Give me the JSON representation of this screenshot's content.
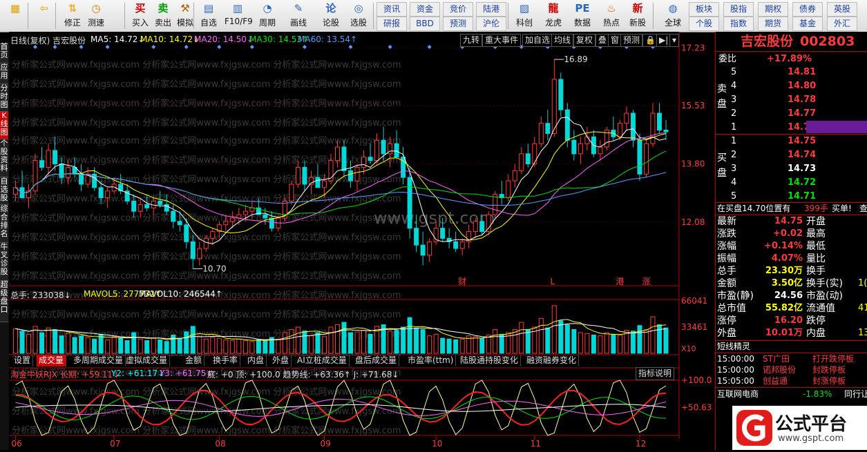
{
  "toolbar": {
    "buttons": [
      {
        "label": "",
        "icon": "grid-icon"
      },
      {
        "label": "",
        "icon": "back-arrow-icon"
      },
      {
        "label": "修正",
        "icon": "updown-icon"
      },
      {
        "label": "测速",
        "icon": "clock-icon"
      },
      {
        "label": "买入",
        "icon": "buy-icon"
      },
      {
        "label": "卖出",
        "icon": "sell-icon"
      },
      {
        "label": "模拟",
        "icon": "hammer-icon"
      },
      {
        "label": "自选",
        "icon": "folder-icon"
      },
      {
        "label": "F10/F9",
        "icon": "f10-icon"
      },
      {
        "label": "周期",
        "icon": "period-icon"
      },
      {
        "label": "画线",
        "icon": "pen-icon"
      },
      {
        "label": "论股",
        "icon": "discuss-icon"
      },
      {
        "label": "选股",
        "icon": "select-icon"
      }
    ],
    "links_row1": [
      "资讯",
      "资金",
      "竞价",
      "陆港"
    ],
    "links_row2": [
      "研报",
      "BBD",
      "预测",
      "沪伦"
    ],
    "buttons2": [
      {
        "label": "科创",
        "icon": "chart-icon"
      },
      {
        "label": "龙虎",
        "icon": "dragon-icon"
      },
      {
        "label": "数据",
        "icon": "pe-icon"
      },
      {
        "label": "热点",
        "icon": "hot-icon"
      },
      {
        "label": "新股",
        "icon": "ipo-icon"
      },
      {
        "label": "全球",
        "icon": "globe-icon"
      }
    ],
    "links2_row1": [
      "板块",
      "股指",
      "期权",
      "债券",
      "英股"
    ],
    "links2_row2": [
      "个股",
      "指数",
      "期货",
      "基金",
      "外汇"
    ]
  },
  "left_tabs": [
    "首页",
    "应用",
    "分时图",
    "K线图",
    "个股资料",
    "自选股",
    "综合排名",
    "牛叉诊股",
    "超级盘口"
  ],
  "header": {
    "title": "日线(复权)  吉宏股份",
    "ma5": "MA5: 14.72↓",
    "ma10": "MA10: 14.72↓",
    "ma20": "MA20: 14.50↓",
    "ma30": "MA30: 14.53↑",
    "ma60": "MA60: 13.54↑"
  },
  "chart_tabs": [
    "九转",
    "重大事件",
    "加自选",
    "均线",
    "复权",
    "叠",
    "窗",
    "预测"
  ],
  "chart_data": {
    "type": "candlestick",
    "title": "吉宏股份 002803 日线(复权)",
    "y_ticks": [
      "17.23",
      "15.53",
      "13.80",
      "12.08"
    ],
    "ylim": [
      10.2,
      17.3
    ],
    "x_labels": [
      "06",
      "07",
      "08",
      "09",
      "10",
      "11",
      "12"
    ],
    "annotations": [
      "16.89",
      "10.70"
    ],
    "event_marks": [
      "财",
      "L",
      "港",
      "涨"
    ],
    "watermark": "分析家公式网www.fxjgsw.com",
    "watermark2": "www.gspt.com",
    "candles": [
      [
        12.9,
        13.3,
        12.7,
        13.1
      ],
      [
        13.1,
        13.6,
        12.9,
        12.8
      ],
      [
        12.8,
        13.2,
        12.5,
        13.0
      ],
      [
        13.0,
        14.1,
        12.9,
        13.9
      ],
      [
        13.9,
        14.3,
        13.6,
        13.7
      ],
      [
        13.7,
        14.4,
        13.5,
        14.2
      ],
      [
        14.2,
        14.6,
        13.6,
        13.8
      ],
      [
        13.8,
        14.0,
        13.2,
        13.4
      ],
      [
        13.4,
        13.9,
        13.2,
        13.7
      ],
      [
        13.7,
        14.0,
        13.4,
        13.5
      ],
      [
        13.5,
        13.8,
        13.0,
        13.2
      ],
      [
        13.2,
        13.7,
        13.1,
        13.5
      ],
      [
        13.5,
        13.7,
        13.0,
        13.1
      ],
      [
        13.1,
        13.3,
        12.6,
        12.8
      ],
      [
        12.8,
        13.1,
        12.5,
        13.0
      ],
      [
        13.0,
        13.4,
        12.9,
        13.2
      ],
      [
        13.2,
        13.5,
        12.9,
        13.0
      ],
      [
        13.0,
        13.2,
        12.6,
        12.7
      ],
      [
        12.7,
        12.9,
        12.2,
        12.4
      ],
      [
        12.4,
        12.8,
        12.2,
        12.6
      ],
      [
        12.6,
        12.9,
        12.4,
        12.5
      ],
      [
        12.5,
        12.8,
        12.3,
        12.7
      ],
      [
        12.7,
        13.0,
        12.5,
        12.6
      ],
      [
        12.6,
        12.9,
        12.3,
        12.4
      ],
      [
        12.4,
        12.6,
        11.9,
        12.1
      ],
      [
        12.1,
        12.4,
        11.8,
        12.0
      ],
      [
        12.0,
        12.2,
        11.3,
        11.5
      ],
      [
        11.5,
        11.7,
        10.7,
        11.0
      ],
      [
        11.0,
        11.5,
        10.8,
        11.3
      ],
      [
        11.3,
        11.7,
        11.2,
        11.6
      ],
      [
        11.6,
        11.9,
        11.4,
        11.8
      ],
      [
        11.8,
        12.1,
        11.6,
        12.0
      ],
      [
        12.0,
        12.3,
        11.8,
        12.1
      ],
      [
        12.1,
        12.4,
        11.9,
        12.2
      ],
      [
        12.2,
        12.5,
        12.0,
        12.3
      ],
      [
        12.3,
        12.6,
        12.1,
        12.4
      ],
      [
        12.4,
        12.7,
        12.2,
        12.5
      ],
      [
        12.5,
        12.8,
        12.3,
        12.3
      ],
      [
        12.3,
        12.5,
        12.0,
        12.2
      ],
      [
        12.2,
        12.4,
        11.8,
        11.9
      ],
      [
        11.9,
        12.3,
        11.8,
        12.2
      ],
      [
        12.2,
        12.8,
        12.1,
        12.7
      ],
      [
        12.7,
        13.3,
        12.6,
        13.2
      ],
      [
        13.2,
        13.9,
        13.1,
        13.7
      ],
      [
        13.7,
        13.9,
        13.0,
        13.2
      ],
      [
        13.2,
        13.6,
        12.9,
        13.4
      ],
      [
        13.4,
        13.8,
        13.1,
        13.1
      ],
      [
        13.1,
        13.5,
        12.8,
        13.3
      ],
      [
        13.3,
        14.1,
        13.2,
        13.9
      ],
      [
        13.9,
        14.5,
        13.7,
        14.3
      ],
      [
        14.3,
        14.5,
        13.4,
        13.6
      ],
      [
        13.6,
        13.9,
        13.1,
        13.3
      ],
      [
        13.3,
        13.8,
        13.0,
        13.7
      ],
      [
        13.7,
        14.2,
        13.5,
        14.0
      ],
      [
        14.0,
        14.4,
        13.8,
        13.9
      ],
      [
        13.9,
        14.7,
        13.8,
        14.5
      ],
      [
        14.5,
        14.9,
        13.9,
        14.1
      ],
      [
        14.1,
        14.6,
        13.7,
        14.4
      ],
      [
        14.4,
        14.8,
        14.0,
        14.0
      ],
      [
        14.0,
        14.3,
        13.2,
        13.4
      ],
      [
        13.4,
        13.7,
        11.6,
        11.9
      ],
      [
        11.9,
        12.3,
        11.2,
        11.4
      ],
      [
        11.4,
        11.8,
        10.8,
        11.1
      ],
      [
        11.1,
        11.6,
        10.9,
        11.5
      ],
      [
        11.5,
        12.1,
        11.4,
        11.9
      ],
      [
        11.9,
        12.2,
        11.5,
        11.6
      ],
      [
        11.6,
        11.9,
        11.3,
        11.5
      ],
      [
        11.5,
        11.8,
        11.2,
        11.3
      ],
      [
        11.3,
        11.6,
        11.1,
        11.5
      ],
      [
        11.5,
        12.0,
        11.3,
        11.8
      ],
      [
        11.8,
        12.2,
        11.6,
        12.1
      ],
      [
        12.1,
        12.3,
        11.7,
        11.8
      ],
      [
        11.8,
        12.4,
        11.7,
        12.3
      ],
      [
        12.3,
        13.0,
        12.2,
        12.9
      ],
      [
        12.9,
        13.3,
        12.6,
        12.8
      ],
      [
        12.8,
        13.5,
        12.7,
        13.3
      ],
      [
        13.3,
        13.8,
        13.1,
        13.6
      ],
      [
        13.6,
        14.3,
        13.5,
        14.1
      ],
      [
        14.1,
        14.4,
        13.7,
        13.8
      ],
      [
        13.8,
        14.6,
        13.7,
        14.4
      ],
      [
        14.4,
        15.2,
        14.3,
        15.0
      ],
      [
        15.0,
        15.4,
        14.5,
        14.7
      ],
      [
        14.7,
        16.89,
        14.6,
        16.3
      ],
      [
        16.3,
        16.5,
        15.2,
        15.4
      ],
      [
        15.4,
        15.6,
        14.3,
        14.5
      ],
      [
        14.5,
        14.8,
        13.9,
        14.1
      ],
      [
        14.1,
        14.6,
        13.8,
        14.4
      ],
      [
        14.4,
        14.9,
        14.2,
        14.6
      ],
      [
        14.6,
        14.8,
        14.0,
        14.1
      ],
      [
        14.1,
        14.5,
        13.9,
        14.3
      ],
      [
        14.3,
        14.9,
        14.2,
        14.8
      ],
      [
        14.8,
        15.2,
        14.5,
        14.6
      ],
      [
        14.6,
        15.1,
        14.5,
        15.0
      ],
      [
        15.0,
        15.5,
        14.8,
        15.3
      ],
      [
        15.3,
        15.4,
        14.3,
        14.5
      ],
      [
        14.5,
        14.7,
        13.3,
        13.5
      ],
      [
        13.5,
        14.5,
        13.4,
        14.4
      ],
      [
        14.4,
        15.6,
        14.3,
        15.3
      ],
      [
        15.3,
        15.6,
        14.7,
        14.8
      ],
      [
        14.8,
        15.1,
        14.5,
        14.75
      ]
    ]
  },
  "volume": {
    "label": "总手: 233038↓",
    "mavol5": "MAVOL5: 277732↑",
    "mavol10": "MAVOL10: 246544↑",
    "y_ticks": [
      "66041",
      "33461"
    ],
    "unit": "X10",
    "values": [
      3.1,
      2.8,
      2.4,
      3.4,
      2.6,
      3.2,
      3.0,
      2.2,
      2.5,
      2.0,
      2.2,
      2.0,
      1.8,
      2.4,
      1.7,
      2.1,
      1.9,
      1.6,
      2.6,
      1.8,
      1.6,
      1.9,
      1.7,
      1.5,
      2.3,
      1.9,
      2.7,
      3.4,
      2.1,
      1.8,
      2.0,
      1.9,
      1.7,
      1.6,
      1.8,
      1.6,
      1.5,
      1.7,
      1.6,
      2.0,
      1.8,
      2.6,
      3.0,
      3.3,
      2.8,
      2.2,
      2.6,
      2.1,
      3.3,
      3.6,
      3.9,
      2.6,
      2.7,
      2.9,
      2.4,
      3.4,
      3.6,
      2.8,
      2.9,
      3.3,
      4.5,
      3.2,
      3.0,
      2.2,
      2.4,
      1.9,
      1.8,
      1.7,
      1.8,
      2.2,
      2.1,
      1.9,
      2.3,
      3.0,
      2.4,
      2.6,
      3.0,
      3.9,
      3.0,
      3.3,
      4.4,
      3.2,
      6.0,
      4.1,
      3.6,
      3.0,
      2.6,
      2.5,
      2.3,
      2.2,
      2.6,
      2.4,
      2.3,
      2.9,
      2.8,
      3.5,
      3.0,
      4.6,
      3.6,
      3.2
    ]
  },
  "volume_tabs": [
    "设置",
    "成交量",
    "多周期成交量",
    "虚拟成交量",
    "金额",
    "换手率",
    "内盘",
    "外盘",
    "AI立桩成交量",
    "盘后成交量",
    "市盈率(ttm)",
    "陆股通持股变化",
    "融资融券变化"
  ],
  "indicator": {
    "label": "淘金牛妖RJX 长期: +59.11↓",
    "y2": "Y2: +61.17↓",
    "y3": "Y3: +61.75↓",
    "rest": "底: +0  顶: +100.0  趋势线: +63.36↑  J: +71.68↓",
    "help": "指标说明",
    "y_ticks": [
      "+100.0",
      "+50.63"
    ]
  },
  "right": {
    "name": "吉宏股份",
    "code": "002803",
    "weibi_label": "委比",
    "weibi": "+17.89%",
    "sell_label": "卖盘",
    "buy_label": "买盘",
    "sells": [
      [
        "5",
        "14.81"
      ],
      [
        "4",
        "14.80"
      ],
      [
        "3",
        "14.78"
      ],
      [
        "2",
        "14.77"
      ],
      [
        "1",
        "14.76"
      ]
    ],
    "buys": [
      [
        "1",
        "14.75"
      ],
      [
        "2",
        "14.74"
      ],
      [
        "3",
        "14.73"
      ],
      [
        "4",
        "14.72"
      ],
      [
        "5",
        "14.71"
      ]
    ],
    "buy_note": "在买盘14.70位置有",
    "buy_note_qty": "399手",
    "buy_note_tag": "买单!",
    "buy_note_more": "查",
    "stats": [
      [
        "最新",
        "14.75",
        "开盘",
        ""
      ],
      [
        "涨跌",
        "+0.02",
        "最高",
        ""
      ],
      [
        "涨幅",
        "+0.14%",
        "最低",
        ""
      ],
      [
        "振幅",
        "4.07%",
        "量比",
        ""
      ],
      [
        "总手",
        "23.30万",
        "换手",
        ""
      ],
      [
        "金额",
        "3.50亿",
        "换手(实)",
        "1("
      ],
      [
        "市盈(静)",
        "24.56",
        "市盈(动)",
        ""
      ],
      [
        "总市值",
        "55.82亿",
        "流通值",
        "41"
      ],
      [
        "涨停",
        "16.20",
        "跌停",
        ""
      ],
      [
        "外盘",
        "10.01万",
        "内盘",
        "13"
      ]
    ],
    "news_title": "短线精灵",
    "news": [
      [
        "15:00:00",
        "ST广田",
        "打开跌停板"
      ],
      [
        "15:00:00",
        "诺邦股份",
        "封跌停板"
      ],
      [
        "15:05:00",
        "创益通",
        "封涨停板"
      ]
    ],
    "sector": "互联网电商",
    "sector_pct": "-1.83%",
    "sector_tab": "同行让"
  },
  "logo": {
    "name": "公式平台",
    "url": "www.gspt.com"
  },
  "colors": {
    "up": "#ff3b3b",
    "down": "#00d8d8",
    "ma5": "#ffffff",
    "ma10": "#ffff00",
    "ma20": "#ff66ff",
    "ma30": "#00e000",
    "ma60": "#5a9bff"
  }
}
